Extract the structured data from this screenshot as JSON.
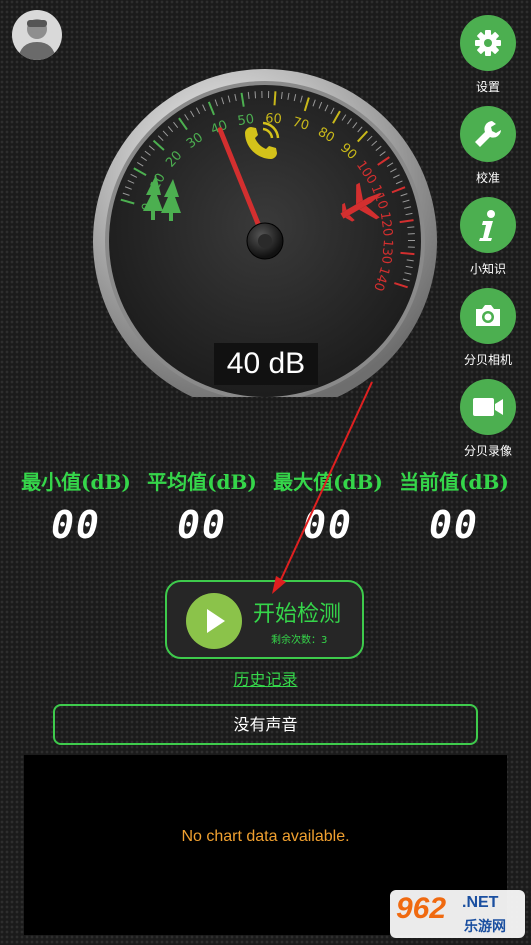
{
  "app": {
    "side_buttons": [
      {
        "label": "设置",
        "icon": "gear-icon"
      },
      {
        "label": "校准",
        "icon": "wrench-icon"
      },
      {
        "label": "小知识",
        "icon": "info-icon"
      },
      {
        "label": "分贝相机",
        "icon": "camera-icon"
      },
      {
        "label": "分贝录像",
        "icon": "video-icon"
      }
    ]
  },
  "gauge": {
    "ticks": [
      "0",
      "10",
      "20",
      "30",
      "40",
      "50",
      "60",
      "70",
      "80",
      "90",
      "100",
      "110",
      "120",
      "130",
      "140"
    ],
    "needle_value": 40,
    "readout": "40 dB",
    "icons": [
      "tree-icon",
      "phone-icon",
      "airplane-icon"
    ]
  },
  "stats": [
    {
      "label": "最小值(dB)",
      "value": "00"
    },
    {
      "label": "平均值(dB)",
      "value": "00"
    },
    {
      "label": "最大值(dB)",
      "value": "00"
    },
    {
      "label": "当前值(dB)",
      "value": "00"
    }
  ],
  "start": {
    "label": "开始检测",
    "remaining": "剩余次数：3"
  },
  "history_link": "历史记录",
  "status": "没有声音",
  "chart": {
    "empty_message": "No chart data available."
  },
  "watermark": {
    "logo": "962",
    "net": ".NET",
    "cn": "乐游网"
  },
  "colors": {
    "accent": "#35d64a",
    "button_green": "#4caf50",
    "needle": "#d32f2f",
    "warning_text": "#f0a030"
  }
}
